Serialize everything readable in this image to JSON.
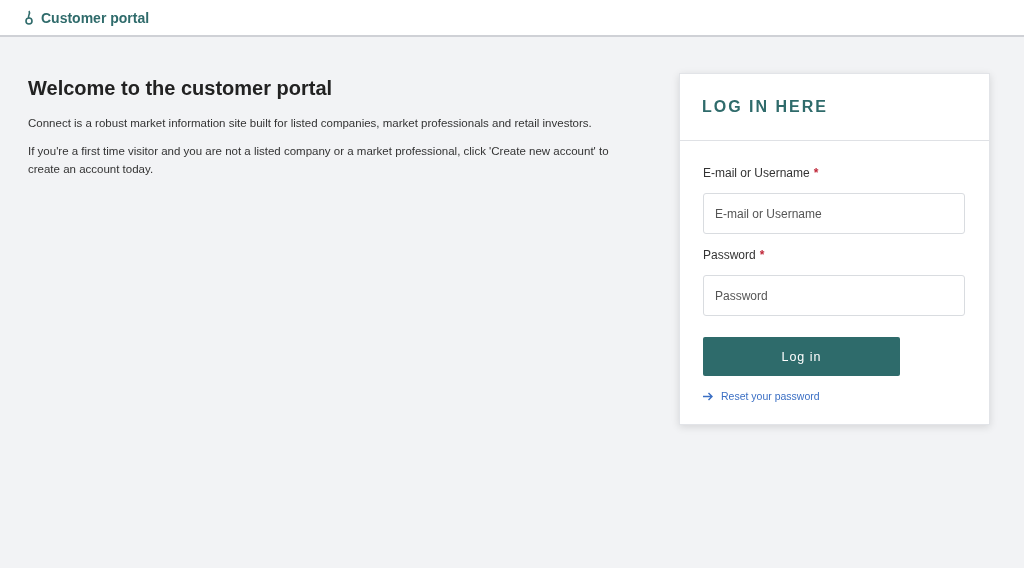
{
  "header": {
    "title": "Customer portal"
  },
  "intro": {
    "heading": "Welcome to the customer portal",
    "paragraphs": [
      "Connect is a robust market information site built for listed companies, market professionals and retail investors.",
      "If you're a first time visitor and you are not a listed company or a market professional, click 'Create new account' to create an account today."
    ]
  },
  "login": {
    "title": "LOG IN HERE",
    "fields": [
      {
        "label": "E-mail or Username",
        "required_mark": "*",
        "placeholder": "E-mail or Username"
      },
      {
        "label": "Password",
        "required_mark": "*",
        "placeholder": "Password"
      }
    ],
    "button": "Log in",
    "reset_link": "Reset your password"
  }
}
